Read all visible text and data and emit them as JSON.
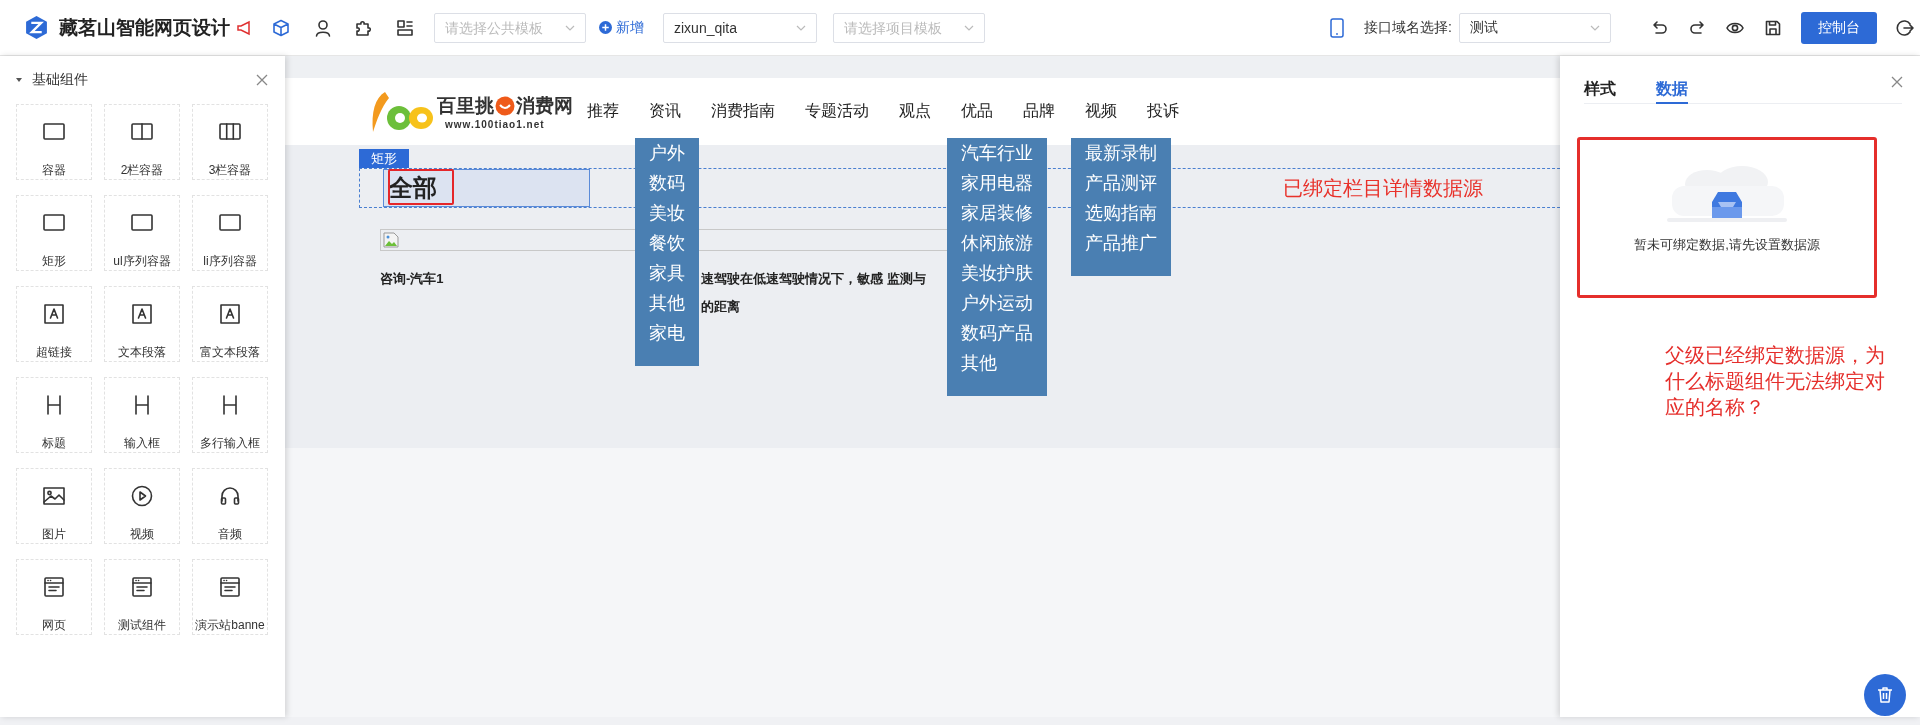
{
  "app": {
    "title": "藏茗山智能网页设计"
  },
  "toolbar": {
    "public_template": {
      "placeholder": "请选择公共模板"
    },
    "add_button": "新增",
    "site_select": {
      "value": "zixun_qita"
    },
    "project_template": {
      "placeholder": "请选择项目模板"
    },
    "domain_label": "接口域名选择:",
    "domain_select": {
      "value": "测试"
    },
    "console_button": "控制台"
  },
  "component_panel": {
    "title": "基础组件",
    "items": [
      {
        "label": "容器",
        "kind": "box"
      },
      {
        "label": "2栏容器",
        "kind": "columns2"
      },
      {
        "label": "3栏容器",
        "kind": "columns3"
      },
      {
        "label": "矩形",
        "kind": "box"
      },
      {
        "label": "ul序列容器",
        "kind": "box"
      },
      {
        "label": "li序列容器",
        "kind": "box"
      },
      {
        "label": "超链接",
        "kind": "text"
      },
      {
        "label": "文本段落",
        "kind": "text"
      },
      {
        "label": "富文本段落",
        "kind": "text"
      },
      {
        "label": "标题",
        "kind": "heading"
      },
      {
        "label": "输入框",
        "kind": "heading"
      },
      {
        "label": "多行输入框",
        "kind": "heading"
      },
      {
        "label": "图片",
        "kind": "image"
      },
      {
        "label": "视频",
        "kind": "video"
      },
      {
        "label": "音频",
        "kind": "audio"
      },
      {
        "label": "网页",
        "kind": "webpage"
      },
      {
        "label": "测试组件",
        "kind": "webpage"
      },
      {
        "label": "演示站banne",
        "kind": "webpage"
      }
    ]
  },
  "canvas": {
    "site_logo": {
      "name": "百里挑",
      "name_suffix": "消费网",
      "url": "www.100tiao1.net"
    },
    "nav": [
      {
        "label": "推荐"
      },
      {
        "label": "资讯",
        "children": [
          "户外",
          "数码",
          "美妆",
          "餐饮",
          "家具",
          "其他",
          "家电"
        ]
      },
      {
        "label": "消费指南"
      },
      {
        "label": "专题活动"
      },
      {
        "label": "观点"
      },
      {
        "label": "优品",
        "children": [
          "汽车行业",
          "家用电器",
          "家居装修",
          "休闲旅游",
          "美妆护肤",
          "户外运动",
          "数码产品",
          "其他"
        ]
      },
      {
        "label": "品牌"
      },
      {
        "label": "视频",
        "children": [
          "最新录制",
          "产品测评",
          "选购指南",
          "产品推广"
        ]
      },
      {
        "label": "投诉"
      }
    ],
    "selection_tag": "矩形",
    "heading": "全部",
    "binding_note": "已绑定栏目详情数据源",
    "article": {
      "title": "咨询-汽车1",
      "summary_lines": [
        "速驾驶在低速驾驶情况下，敏感 监测与",
        "的距离"
      ]
    }
  },
  "properties_panel": {
    "tabs": [
      {
        "label": "样式",
        "selected": false
      },
      {
        "label": "数据",
        "selected": true
      }
    ],
    "empty_text": "暂未可绑定数据,请先设置数据源",
    "note": "父级已经绑定数据源，为什么标题组件无法绑定对应的名称？"
  }
}
